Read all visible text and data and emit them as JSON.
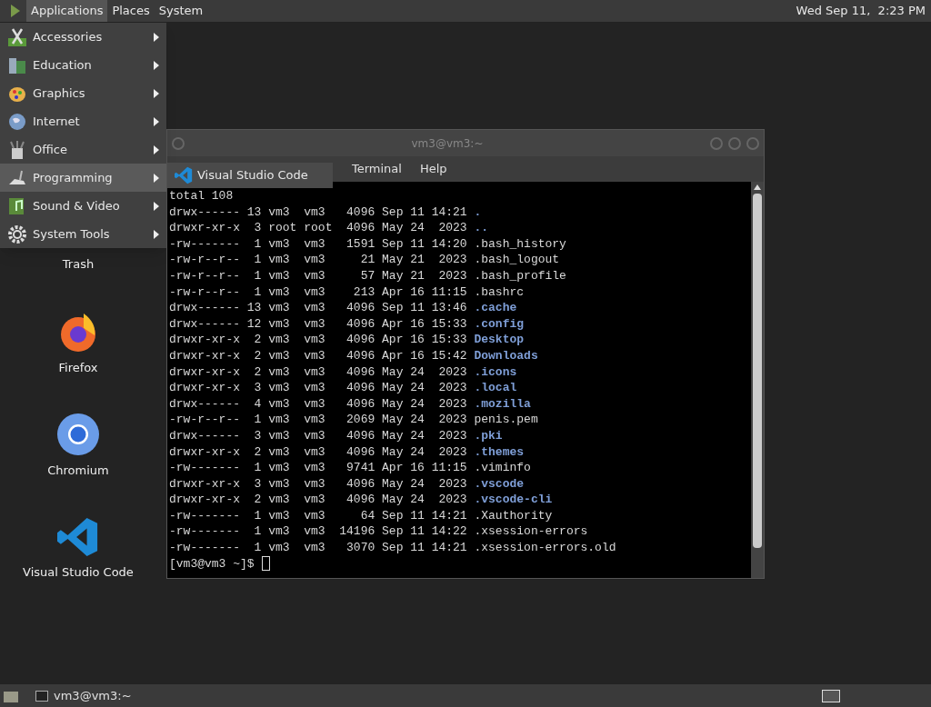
{
  "top_panel": {
    "menus": [
      {
        "label": "Applications",
        "selected": true
      },
      {
        "label": "Places",
        "selected": false
      },
      {
        "label": "System",
        "selected": false
      }
    ],
    "clock": "Wed Sep 11,  2:23 PM"
  },
  "applications_menu": {
    "items": [
      {
        "label": "Accessories",
        "kind": "accessories",
        "selected": false
      },
      {
        "label": "Education",
        "kind": "education",
        "selected": false
      },
      {
        "label": "Graphics",
        "kind": "graphics",
        "selected": false
      },
      {
        "label": "Internet",
        "kind": "internet",
        "selected": false
      },
      {
        "label": "Office",
        "kind": "office",
        "selected": false
      },
      {
        "label": "Programming",
        "kind": "programming",
        "selected": true
      },
      {
        "label": "Sound & Video",
        "kind": "sound_video",
        "selected": false
      },
      {
        "label": "System Tools",
        "kind": "system_tools",
        "selected": false
      }
    ],
    "submenu": {
      "items": [
        {
          "label": "Visual Studio Code",
          "kind": "vscode"
        }
      ]
    }
  },
  "desktop_icons": [
    {
      "label": "Trash",
      "kind": "trash"
    },
    {
      "label": "Firefox",
      "kind": "firefox"
    },
    {
      "label": "Chromium",
      "kind": "chromium"
    },
    {
      "label": "Visual Studio Code",
      "kind": "vscode"
    }
  ],
  "terminal": {
    "title": "vm3@vm3:~",
    "menu": [
      "Terminal",
      "Help"
    ],
    "header": "total 108",
    "rows": [
      {
        "info": "drwx------ 13 vm3  vm3   4096 Sep 11 14:21",
        "name": ".",
        "kind": "dir"
      },
      {
        "info": "drwxr-xr-x  3 root root  4096 May 24  2023",
        "name": "..",
        "kind": "dir"
      },
      {
        "info": "-rw-------  1 vm3  vm3   1591 Sep 11 14:20",
        "name": ".bash_history",
        "kind": "file"
      },
      {
        "info": "-rw-r--r--  1 vm3  vm3     21 May 21  2023",
        "name": ".bash_logout",
        "kind": "file"
      },
      {
        "info": "-rw-r--r--  1 vm3  vm3     57 May 21  2023",
        "name": ".bash_profile",
        "kind": "file"
      },
      {
        "info": "-rw-r--r--  1 vm3  vm3    213 Apr 16 11:15",
        "name": ".bashrc",
        "kind": "file"
      },
      {
        "info": "drwx------ 13 vm3  vm3   4096 Sep 11 13:46",
        "name": ".cache",
        "kind": "dir"
      },
      {
        "info": "drwx------ 12 vm3  vm3   4096 Apr 16 15:33",
        "name": ".config",
        "kind": "dir"
      },
      {
        "info": "drwxr-xr-x  2 vm3  vm3   4096 Apr 16 15:33",
        "name": "Desktop",
        "kind": "dir"
      },
      {
        "info": "drwxr-xr-x  2 vm3  vm3   4096 Apr 16 15:42",
        "name": "Downloads",
        "kind": "dir"
      },
      {
        "info": "drwxr-xr-x  2 vm3  vm3   4096 May 24  2023",
        "name": ".icons",
        "kind": "dir"
      },
      {
        "info": "drwxr-xr-x  3 vm3  vm3   4096 May 24  2023",
        "name": ".local",
        "kind": "dir"
      },
      {
        "info": "drwx------  4 vm3  vm3   4096 May 24  2023",
        "name": ".mozilla",
        "kind": "dir"
      },
      {
        "info": "-rw-r--r--  1 vm3  vm3   2069 May 24  2023",
        "name": "penis.pem",
        "kind": "file"
      },
      {
        "info": "drwx------  3 vm3  vm3   4096 May 24  2023",
        "name": ".pki",
        "kind": "dir"
      },
      {
        "info": "drwxr-xr-x  2 vm3  vm3   4096 May 24  2023",
        "name": ".themes",
        "kind": "dir"
      },
      {
        "info": "-rw-------  1 vm3  vm3   9741 Apr 16 11:15",
        "name": ".viminfo",
        "kind": "file"
      },
      {
        "info": "drwxr-xr-x  3 vm3  vm3   4096 May 24  2023",
        "name": ".vscode",
        "kind": "dir"
      },
      {
        "info": "drwxr-xr-x  2 vm3  vm3   4096 May 24  2023",
        "name": ".vscode-cli",
        "kind": "dir"
      },
      {
        "info": "-rw-------  1 vm3  vm3     64 Sep 11 14:21",
        "name": ".Xauthority",
        "kind": "file"
      },
      {
        "info": "-rw-------  1 vm3  vm3  14196 Sep 11 14:22",
        "name": ".xsession-errors",
        "kind": "file"
      },
      {
        "info": "-rw-------  1 vm3  vm3   3070 Sep 11 14:21",
        "name": ".xsession-errors.old",
        "kind": "file"
      }
    ],
    "prompt": "[vm3@vm3 ~]$"
  },
  "taskbar": {
    "items": [
      {
        "label": "vm3@vm3:~",
        "selected": false
      }
    ]
  }
}
